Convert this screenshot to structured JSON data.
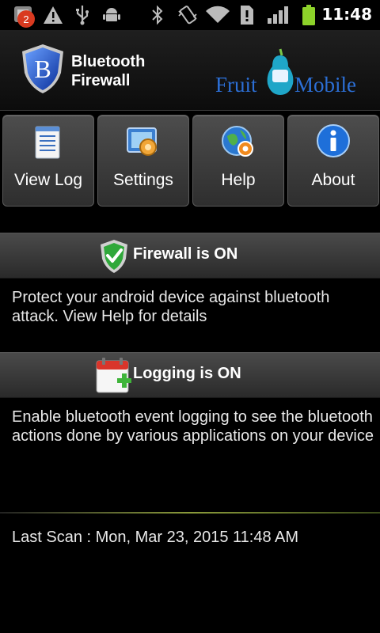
{
  "status_bar": {
    "notification_count": "2",
    "time": "11:48",
    "icons": [
      "app-notification-icon",
      "warning-icon",
      "usb-icon",
      "android-debug-icon",
      "bluetooth-icon",
      "vibrate-icon",
      "wifi-icon",
      "sim-alert-icon",
      "signal-icon",
      "battery-icon"
    ]
  },
  "header": {
    "app_title_line1": "Bluetooth",
    "app_title_line2": "Firewall",
    "brand_left": "Fruit",
    "brand_right": "Mobile",
    "logo_letter": "B"
  },
  "menu": [
    {
      "label": "View Log",
      "icon": "log-document-icon"
    },
    {
      "label": "Settings",
      "icon": "settings-icon"
    },
    {
      "label": "Help",
      "icon": "help-globe-icon"
    },
    {
      "label": "About",
      "icon": "info-icon"
    }
  ],
  "firewall": {
    "title": "Firewall is ON",
    "description": "Protect your android device against bluetooth attack. View Help for details"
  },
  "logging": {
    "title": "Logging is ON",
    "description": "Enable bluetooth event logging to see the bluetooth actions done by various applications on your device"
  },
  "last_scan": "Last Scan : Mon, Mar 23, 2015 11:48 AM",
  "colors": {
    "brand_blue": "#2c6fd6",
    "shield_green": "#2fa83a",
    "info_blue": "#1e6fd9",
    "badge_red": "#d93a20"
  }
}
